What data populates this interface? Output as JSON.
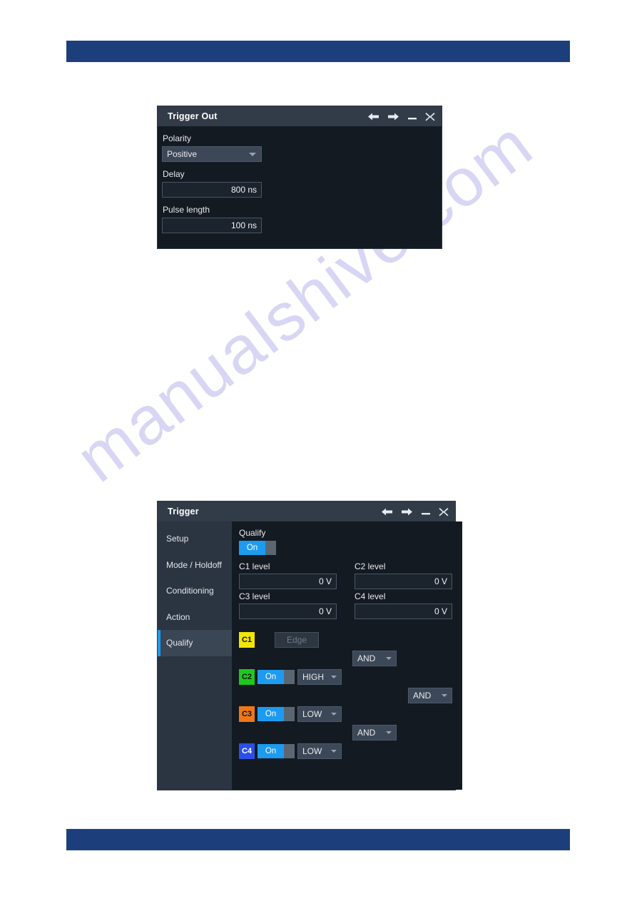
{
  "page": {
    "top_bar_color": "#1c3f7c",
    "bottom_bar_color": "#1c3f7c",
    "watermark_text": "manualshive.com"
  },
  "trigger_out_dialog": {
    "title": "Trigger Out",
    "window_icons": [
      "back-arrow-icon",
      "forward-arrow-icon",
      "minimize-icon",
      "close-icon"
    ],
    "fields": [
      {
        "label": "Polarity",
        "type": "combo",
        "value": "Positive"
      },
      {
        "label": "Delay",
        "type": "number",
        "value": "800 ns"
      },
      {
        "label": "Pulse length",
        "type": "number",
        "value": "100 ns"
      }
    ]
  },
  "trigger_dialog": {
    "title": "Trigger",
    "window_icons": [
      "back-arrow-icon",
      "forward-arrow-icon",
      "minimize-icon",
      "close-icon"
    ],
    "sidebar": {
      "items": [
        {
          "label": "Setup",
          "selected": false
        },
        {
          "label": "Mode / Holdoff",
          "selected": false
        },
        {
          "label": "Conditioning",
          "selected": false
        },
        {
          "label": "Action",
          "selected": false
        },
        {
          "label": "Qualify",
          "selected": true
        }
      ]
    },
    "qualify": {
      "label": "Qualify",
      "toggle_value": "On",
      "levels": [
        {
          "label": "C1 level",
          "value": "0 V"
        },
        {
          "label": "C2 level",
          "value": "0 V"
        },
        {
          "label": "C3 level",
          "value": "0 V"
        },
        {
          "label": "C4 level",
          "value": "0 V"
        }
      ],
      "channels": [
        {
          "name": "C1",
          "color": "#f2e500",
          "has_toggle": false,
          "toggle_value": "",
          "state": "Edge",
          "state_disabled": true
        },
        {
          "name": "C2",
          "color": "#1ec81e",
          "has_toggle": true,
          "toggle_value": "On",
          "state": "HIGH",
          "state_disabled": false
        },
        {
          "name": "C3",
          "color": "#f07818",
          "has_toggle": true,
          "toggle_value": "On",
          "state": "LOW",
          "state_disabled": false
        },
        {
          "name": "C4",
          "color": "#2b4fe8",
          "has_toggle": true,
          "toggle_value": "On",
          "state": "LOW",
          "state_disabled": false
        }
      ],
      "combiners": [
        {
          "value": "AND"
        },
        {
          "value": "AND"
        },
        {
          "value": "AND"
        }
      ]
    }
  }
}
